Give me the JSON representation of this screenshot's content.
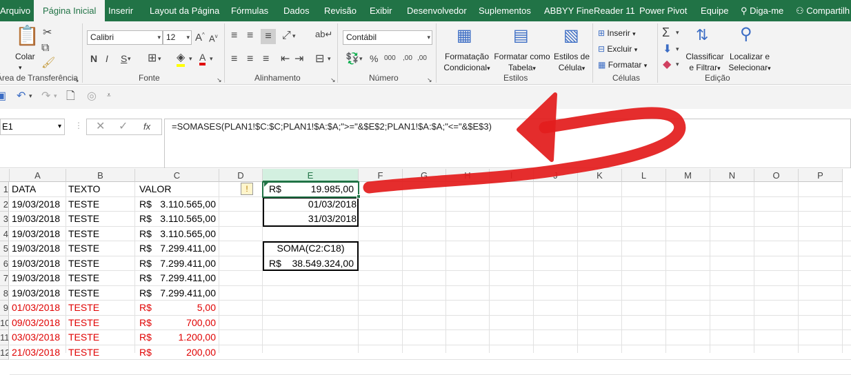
{
  "tabs": [
    "Arquivo",
    "Página Inicial",
    "Inserir",
    "Layout da Página",
    "Fórmulas",
    "Dados",
    "Revisão",
    "Exibir",
    "Desenvolvedor",
    "Suplementos",
    "ABBYY FineReader 11",
    "Power Pivot",
    "Equipe",
    "Diga-me",
    "Compartilh"
  ],
  "ribbon": {
    "clipboard": {
      "paste": "Colar",
      "label": "Área de Transferência"
    },
    "font": {
      "name": "Calibri",
      "size": "12",
      "bold": "N",
      "italic": "I",
      "underline": "S",
      "label": "Fonte"
    },
    "alignment": {
      "label": "Alinhamento"
    },
    "number": {
      "format": "Contábil",
      "label": "Número",
      "percent": "%",
      "thousands": "000",
      "inc_decimal": ",00",
      "dec_decimal": ",00"
    },
    "styles": {
      "conditional_1": "Formatação",
      "conditional_2": "Condicional",
      "table_1": "Formatar como",
      "table_2": "Tabela",
      "cell_1": "Estilos de",
      "cell_2": "Célula",
      "label": "Estilos"
    },
    "cells": {
      "insert": "Inserir",
      "delete": "Excluir",
      "format": "Formatar",
      "label": "Células"
    },
    "editing": {
      "sort_1": "Classificar",
      "sort_2": "e Filtrar",
      "find_1": "Localizar e",
      "find_2": "Selecionar",
      "label": "Edição"
    }
  },
  "formula_bar": {
    "name_box": "E1",
    "formula": "=SOMASES(PLAN1!$C:$C;PLAN1!$A:$A;\">=\"&$E$2;PLAN1!$A:$A;\"<=\"&$E$3)"
  },
  "columns": [
    "A",
    "B",
    "C",
    "D",
    "E",
    "F",
    "G",
    "H",
    "I",
    "J",
    "K",
    "L",
    "M",
    "N",
    "O",
    "P"
  ],
  "rows": [
    "1",
    "2",
    "3",
    "4",
    "5",
    "6",
    "7",
    "8",
    "9",
    "10",
    "11",
    "12"
  ],
  "cells": {
    "A": [
      "DATA",
      "19/03/2018",
      "19/03/2018",
      "19/03/2018",
      "19/03/2018",
      "19/03/2018",
      "19/03/2018",
      "19/03/2018",
      "01/03/2018",
      "09/03/2018",
      "03/03/2018",
      "21/03/2018"
    ],
    "B": [
      "TEXTO",
      "TESTE",
      "TESTE",
      "TESTE",
      "TESTE",
      "TESTE",
      "TESTE",
      "TESTE",
      "TESTE",
      "TESTE",
      "TESTE",
      "TESTE"
    ],
    "C_label": "VALOR",
    "C_currency": [
      "R$",
      "R$",
      "R$",
      "R$",
      "R$",
      "R$",
      "R$",
      "R$",
      "R$",
      "R$",
      "R$"
    ],
    "C_amount": [
      "3.110.565,00",
      "3.110.565,00",
      "3.110.565,00",
      "7.299.411,00",
      "7.299.411,00",
      "7.299.411,00",
      "7.299.411,00",
      "5,00",
      "700,00",
      "1.200,00",
      "200,00"
    ],
    "E1_currency": "R$",
    "E1_amount": "19.985,00",
    "E2": "01/03/2018",
    "E3": "31/03/2018",
    "E5": "SOMA(C2:C18)",
    "E6_currency": "R$",
    "E6_amount": "38.549.324,00"
  },
  "colors": {
    "excel_green": "#217346",
    "annotation_red": "#e31d1d",
    "red_text": "#e00000"
  }
}
